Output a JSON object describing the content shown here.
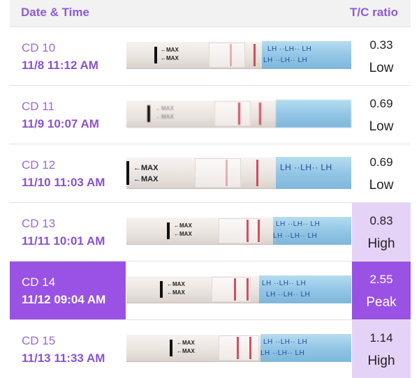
{
  "header": {
    "date_time_label": "Date & Time",
    "ratio_label": "T/C ratio"
  },
  "strip_text": {
    "max_label": "←MAX",
    "brand_text": "LH  ··LH·· LH"
  },
  "rows": [
    {
      "cd": "CD 10",
      "date": "11/8   11:12 AM",
      "ratio": "0.33",
      "level": "Low",
      "level_style": "low",
      "selected": false
    },
    {
      "cd": "CD 11",
      "date": "11/9   10:07 AM",
      "ratio": "0.69",
      "level": "Low",
      "level_style": "low",
      "selected": false
    },
    {
      "cd": "CD 12",
      "date": "11/10   11:03 AM",
      "ratio": "0.69",
      "level": "Low",
      "level_style": "low",
      "selected": false
    },
    {
      "cd": "CD 13",
      "date": "11/11   10:01 AM",
      "ratio": "0.83",
      "level": "High",
      "level_style": "high",
      "selected": false
    },
    {
      "cd": "CD 14",
      "date": "11/12   09:04 AM",
      "ratio": "2.55",
      "level": "Peak",
      "level_style": "peak",
      "selected": true
    },
    {
      "cd": "CD 15",
      "date": "11/13   11:33 AM",
      "ratio": "1.14",
      "level": "High",
      "level_style": "high",
      "selected": false
    }
  ],
  "colors": {
    "accent": "#9a52e5",
    "header_text": "#8f5bd6",
    "high_bg": "#e5d2f7",
    "header_bg": "#f2f2f2"
  }
}
